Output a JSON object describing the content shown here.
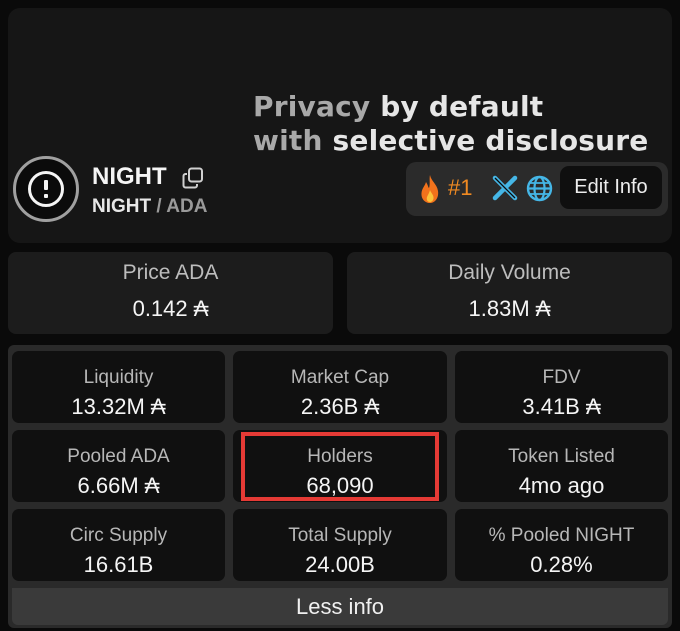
{
  "banner": {
    "tagline_word1": "Privacy",
    "tagline_word2": "by default",
    "tagline_word3": "with",
    "tagline_word4": "selective disclosure"
  },
  "token": {
    "name": "NIGHT",
    "pair_base": "NIGHT",
    "pair_sep": " / ",
    "pair_quote": "ADA",
    "copy_icon": "copy-icon",
    "logo_icon": "night-logo"
  },
  "actions": {
    "rank": "#1",
    "rank_color": "#f08a22",
    "edit_label": "Edit Info",
    "icons": [
      "fire-icon",
      "x-icon",
      "globe-icon"
    ]
  },
  "top_stats": [
    {
      "label": "Price ADA",
      "value": "0.142 ₳"
    },
    {
      "label": "Daily Volume",
      "value": "1.83M ₳"
    }
  ],
  "stats": [
    {
      "label": "Liquidity",
      "value": "13.32M ₳"
    },
    {
      "label": "Market Cap",
      "value": "2.36B ₳"
    },
    {
      "label": "FDV",
      "value": "3.41B ₳"
    },
    {
      "label": "Pooled ADA",
      "value": "6.66M ₳"
    },
    {
      "label": "Holders",
      "value": "68,090"
    },
    {
      "label": "Token Listed",
      "value": "4mo ago"
    },
    {
      "label": "Circ Supply",
      "value": "16.61B"
    },
    {
      "label": "Total Supply",
      "value": "24.00B"
    },
    {
      "label": "% Pooled NIGHT",
      "value": "0.28%"
    }
  ],
  "highlight_color": "#e53a35",
  "footer": {
    "less_info_label": "Less info"
  }
}
